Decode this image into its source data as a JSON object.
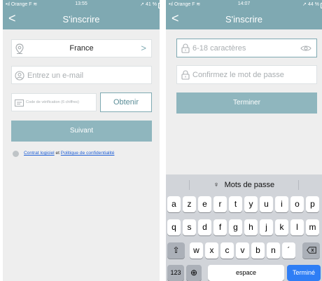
{
  "left": {
    "status": {
      "carrier": "Orange F",
      "time": "13:55",
      "battery": "41 %"
    },
    "nav": {
      "back": "<",
      "title": "S'inscrire"
    },
    "country": {
      "value": "France",
      "arrow": ">"
    },
    "email": {
      "placeholder": "Entrez un e-mail"
    },
    "code": {
      "placeholder": "Code de vérification (6 chiffres)",
      "obtain_label": "Obtenir"
    },
    "next_label": "Suivant",
    "agreement": {
      "contract": "Contrat logiciel",
      "and": " et ",
      "privacy": "Politique de confidentialité"
    }
  },
  "right": {
    "status": {
      "carrier": "Orange F",
      "time": "14:07",
      "battery": "44 %"
    },
    "nav": {
      "back": "<",
      "title": "S'inscrire"
    },
    "password": {
      "placeholder": "6-18 caractères"
    },
    "confirm": {
      "placeholder": "Confirmez le mot de passe"
    },
    "finish_label": "Terminer",
    "keyboard": {
      "suggestion": "Mots de passe",
      "row1": [
        "a",
        "z",
        "e",
        "r",
        "t",
        "y",
        "u",
        "i",
        "o",
        "p"
      ],
      "row2": [
        "q",
        "s",
        "d",
        "f",
        "g",
        "h",
        "j",
        "k",
        "l",
        "m"
      ],
      "row3": [
        "w",
        "x",
        "c",
        "v",
        "b",
        "n",
        "´"
      ],
      "numbers": "123",
      "space": "espace",
      "done": "Terminé"
    }
  },
  "colors": {
    "accent": "#7fa9b2",
    "button": "#8fb6be",
    "link": "#1f5fd6",
    "done": "#2f7ef5"
  }
}
